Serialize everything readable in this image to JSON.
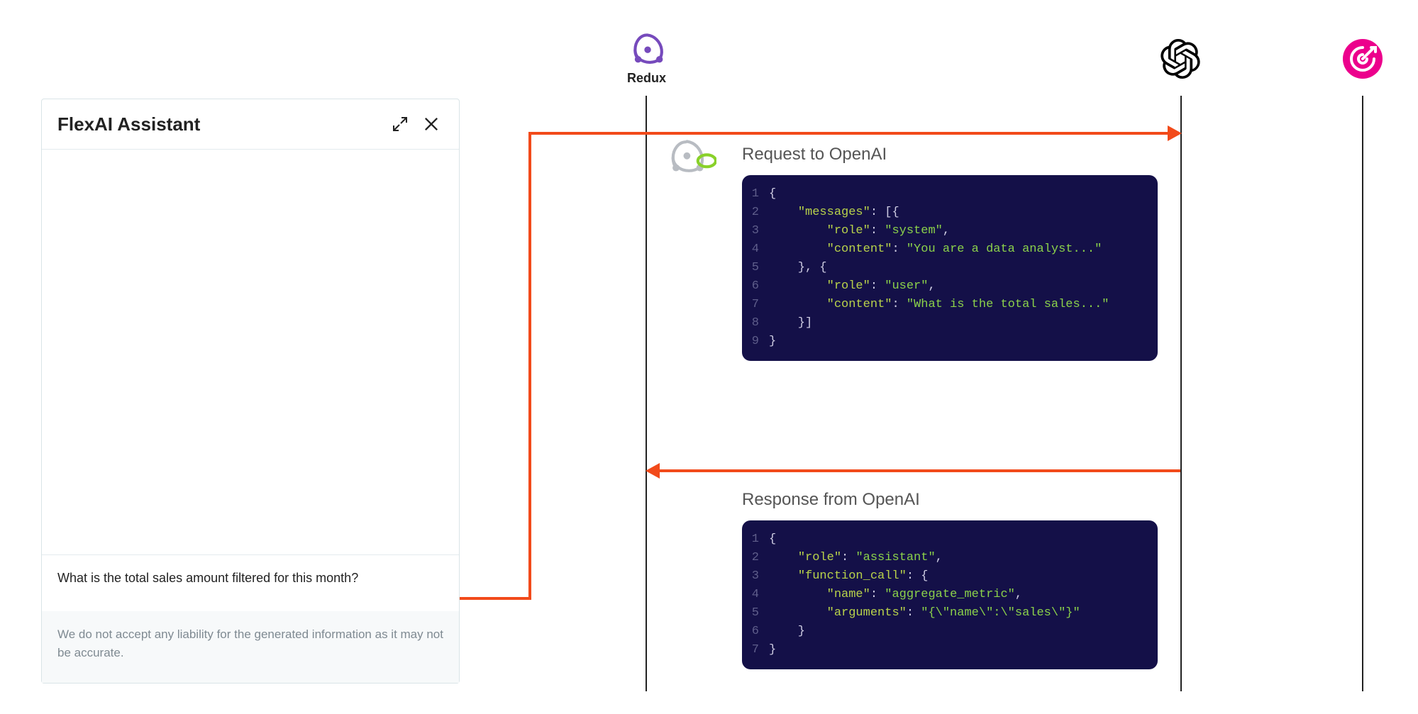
{
  "chat": {
    "title": "FlexAI Assistant",
    "input_text": "What is the total sales amount filtered for this month?",
    "disclaimer": "We do not accept any liability for the generated information as it may not be accurate."
  },
  "actors": {
    "redux": {
      "label": "Redux"
    }
  },
  "sections": {
    "request_title": "Request to OpenAI",
    "response_title": "Response from OpenAI"
  },
  "code_request": {
    "lines": [
      [
        {
          "t": "tkp",
          "v": "{"
        }
      ],
      [
        {
          "t": "tkp",
          "v": "    "
        },
        {
          "t": "tkk",
          "v": "\"messages\""
        },
        {
          "t": "tkp",
          "v": ": [{"
        }
      ],
      [
        {
          "t": "tkp",
          "v": "        "
        },
        {
          "t": "tkk",
          "v": "\"role\""
        },
        {
          "t": "tkp",
          "v": ": "
        },
        {
          "t": "tks",
          "v": "\"system\""
        },
        {
          "t": "tkp",
          "v": ","
        }
      ],
      [
        {
          "t": "tkp",
          "v": "        "
        },
        {
          "t": "tkk",
          "v": "\"content\""
        },
        {
          "t": "tkp",
          "v": ": "
        },
        {
          "t": "tks",
          "v": "\"You are a data analyst...\""
        }
      ],
      [
        {
          "t": "tkp",
          "v": "    }, {"
        }
      ],
      [
        {
          "t": "tkp",
          "v": "        "
        },
        {
          "t": "tkk",
          "v": "\"role\""
        },
        {
          "t": "tkp",
          "v": ": "
        },
        {
          "t": "tks",
          "v": "\"user\""
        },
        {
          "t": "tkp",
          "v": ","
        }
      ],
      [
        {
          "t": "tkp",
          "v": "        "
        },
        {
          "t": "tkk",
          "v": "\"content\""
        },
        {
          "t": "tkp",
          "v": ": "
        },
        {
          "t": "tks",
          "v": "\"What is the total sales...\""
        }
      ],
      [
        {
          "t": "tkp",
          "v": "    }]"
        }
      ],
      [
        {
          "t": "tkp",
          "v": "}"
        }
      ]
    ]
  },
  "code_response": {
    "lines": [
      [
        {
          "t": "tkp",
          "v": "{"
        }
      ],
      [
        {
          "t": "tkp",
          "v": "    "
        },
        {
          "t": "tkk",
          "v": "\"role\""
        },
        {
          "t": "tkp",
          "v": ": "
        },
        {
          "t": "tks",
          "v": "\"assistant\""
        },
        {
          "t": "tkp",
          "v": ","
        }
      ],
      [
        {
          "t": "tkp",
          "v": "    "
        },
        {
          "t": "tkk",
          "v": "\"function_call\""
        },
        {
          "t": "tkp",
          "v": ": {"
        }
      ],
      [
        {
          "t": "tkp",
          "v": "        "
        },
        {
          "t": "tkk",
          "v": "\"name\""
        },
        {
          "t": "tkp",
          "v": ": "
        },
        {
          "t": "tks",
          "v": "\"aggregate_metric\""
        },
        {
          "t": "tkp",
          "v": ","
        }
      ],
      [
        {
          "t": "tkp",
          "v": "        "
        },
        {
          "t": "tkk",
          "v": "\"arguments\""
        },
        {
          "t": "tkp",
          "v": ": "
        },
        {
          "t": "tks",
          "v": "\"{\\\"name\\\":\\\"sales\\\"}\""
        }
      ],
      [
        {
          "t": "tkp",
          "v": "    }"
        }
      ],
      [
        {
          "t": "tkp",
          "v": "}"
        }
      ]
    ]
  }
}
